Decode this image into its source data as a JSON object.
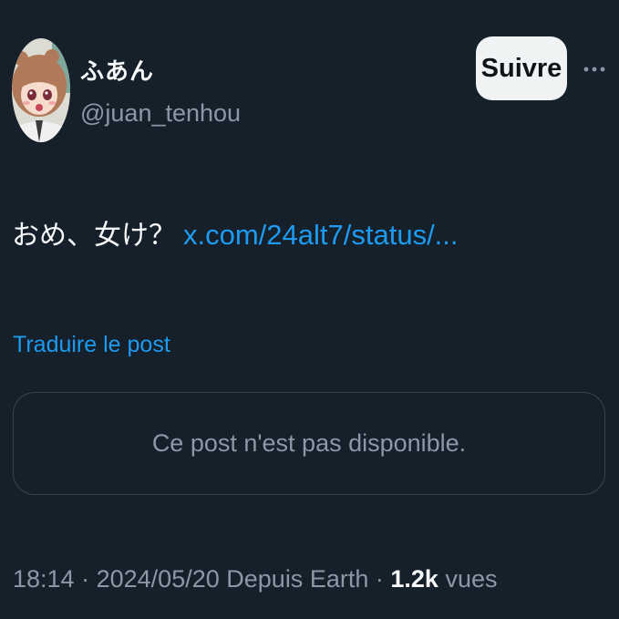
{
  "user": {
    "display_name": "ふあん",
    "handle": "@juan_tenhou"
  },
  "actions": {
    "follow_label": "Suivre",
    "more_icon": "more-horizontal-icon"
  },
  "post": {
    "text": "おめ、女け？",
    "link_text": "x.com/24alt7/status/..."
  },
  "translate_label": "Traduire le post",
  "quoted_card": {
    "message": "Ce post n'est pas disponible."
  },
  "meta": {
    "time": "18:14",
    "date": "2024/05/20",
    "source": "Depuis Earth",
    "separator": "·",
    "views_count": "1.2k",
    "views_label": "vues"
  },
  "colors": {
    "background": "#15202b",
    "accent": "#1d9bf0",
    "text_primary": "#f7f9f9",
    "text_secondary": "#8b98a5",
    "border": "#38444d",
    "button_bg": "#eff3f4"
  }
}
